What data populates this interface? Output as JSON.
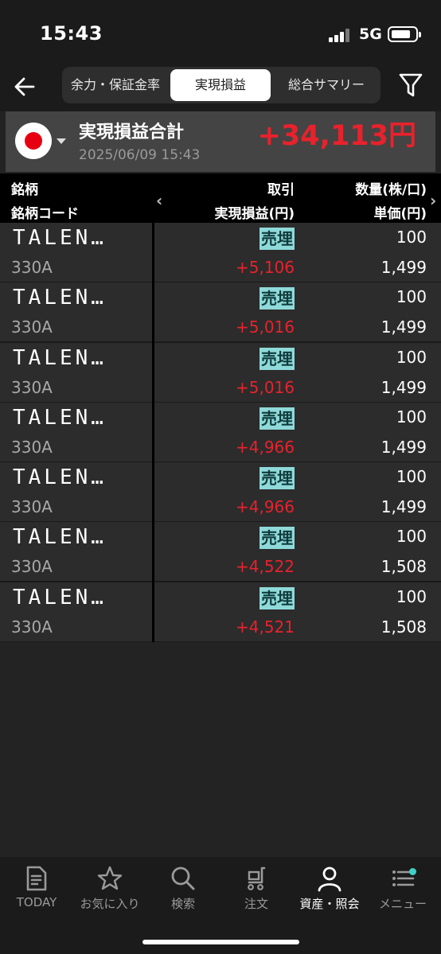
{
  "status_bar": {
    "time": "15:43",
    "network": "5G"
  },
  "header": {
    "tabs": [
      {
        "label": "余力・保証金率"
      },
      {
        "label": "実現損益"
      },
      {
        "label": "総合サマリー"
      }
    ],
    "active_tab": 1
  },
  "summary": {
    "title": "実現損益合計",
    "date": "2025/06/09 15:43",
    "amount": "+34,113円"
  },
  "columns": {
    "name": "銘柄",
    "code": "銘柄コード",
    "trade": "取引",
    "pnl": "実現損益(円)",
    "qty": "数量(株/口)",
    "price": "単価(円)"
  },
  "rows": [
    {
      "name": "TALEN…",
      "code": "330A",
      "trade": "売埋",
      "pnl": "+5,106",
      "qty": "100",
      "price": "1,499"
    },
    {
      "name": "TALEN…",
      "code": "330A",
      "trade": "売埋",
      "pnl": "+5,016",
      "qty": "100",
      "price": "1,499"
    },
    {
      "name": "TALEN…",
      "code": "330A",
      "trade": "売埋",
      "pnl": "+5,016",
      "qty": "100",
      "price": "1,499"
    },
    {
      "name": "TALEN…",
      "code": "330A",
      "trade": "売埋",
      "pnl": "+4,966",
      "qty": "100",
      "price": "1,499"
    },
    {
      "name": "TALEN…",
      "code": "330A",
      "trade": "売埋",
      "pnl": "+4,966",
      "qty": "100",
      "price": "1,499"
    },
    {
      "name": "TALEN…",
      "code": "330A",
      "trade": "売埋",
      "pnl": "+4,522",
      "qty": "100",
      "price": "1,508"
    },
    {
      "name": "TALEN…",
      "code": "330A",
      "trade": "売埋",
      "pnl": "+4,521",
      "qty": "100",
      "price": "1,508"
    }
  ],
  "bottom_nav": [
    {
      "label": "TODAY",
      "icon": "document-icon"
    },
    {
      "label": "お気に入り",
      "icon": "star-icon"
    },
    {
      "label": "検索",
      "icon": "search-icon"
    },
    {
      "label": "注文",
      "icon": "cart-icon"
    },
    {
      "label": "資産・照会",
      "icon": "person-icon"
    },
    {
      "label": "メニュー",
      "icon": "menu-icon"
    }
  ],
  "colors": {
    "profit": "#e8222c",
    "trade_badge": "#8fd9d9",
    "active_tab_bg": "#ffffff"
  }
}
